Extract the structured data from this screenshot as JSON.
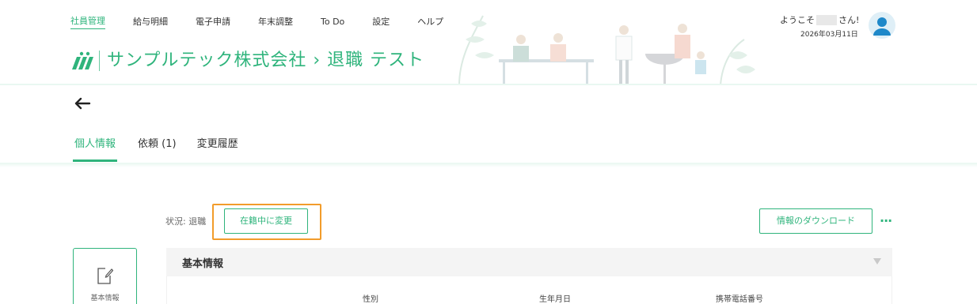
{
  "nav": {
    "items": [
      {
        "label": "社員管理",
        "active": true
      },
      {
        "label": "給与明細",
        "active": false
      },
      {
        "label": "電子申請",
        "active": false
      },
      {
        "label": "年末調整",
        "active": false
      },
      {
        "label": "To Do",
        "active": false
      },
      {
        "label": "設定",
        "active": false
      },
      {
        "label": "ヘルプ",
        "active": false
      }
    ]
  },
  "brand": {
    "title": "サンプルテック株式会社 › 退職 テスト",
    "logo_icon": "jinjer-style-logo-icon"
  },
  "user": {
    "welcome_prefix": "ようこそ",
    "welcome_suffix": "さん!",
    "date": "2026年03月11日",
    "avatar_icon": "user-avatar-icon"
  },
  "subheader": {
    "back_icon": "back-arrow-icon",
    "tabs": [
      {
        "label": "個人情報",
        "active": true
      },
      {
        "label": "依頼 (1)",
        "active": false
      },
      {
        "label": "変更履歴",
        "active": false
      }
    ]
  },
  "status": {
    "label": "状況: 退職",
    "change_button": "在籍中に変更"
  },
  "actions": {
    "download_button": "情報のダウンロード",
    "more_label": "···"
  },
  "side": {
    "card_label": "基本情報",
    "card_icon": "edit-document-icon"
  },
  "section": {
    "title": "基本情報",
    "columns": [
      "性別",
      "生年月日",
      "携帯電話番号"
    ]
  },
  "colors": {
    "accent": "#2fb47c",
    "highlight": "#f29c2b"
  }
}
